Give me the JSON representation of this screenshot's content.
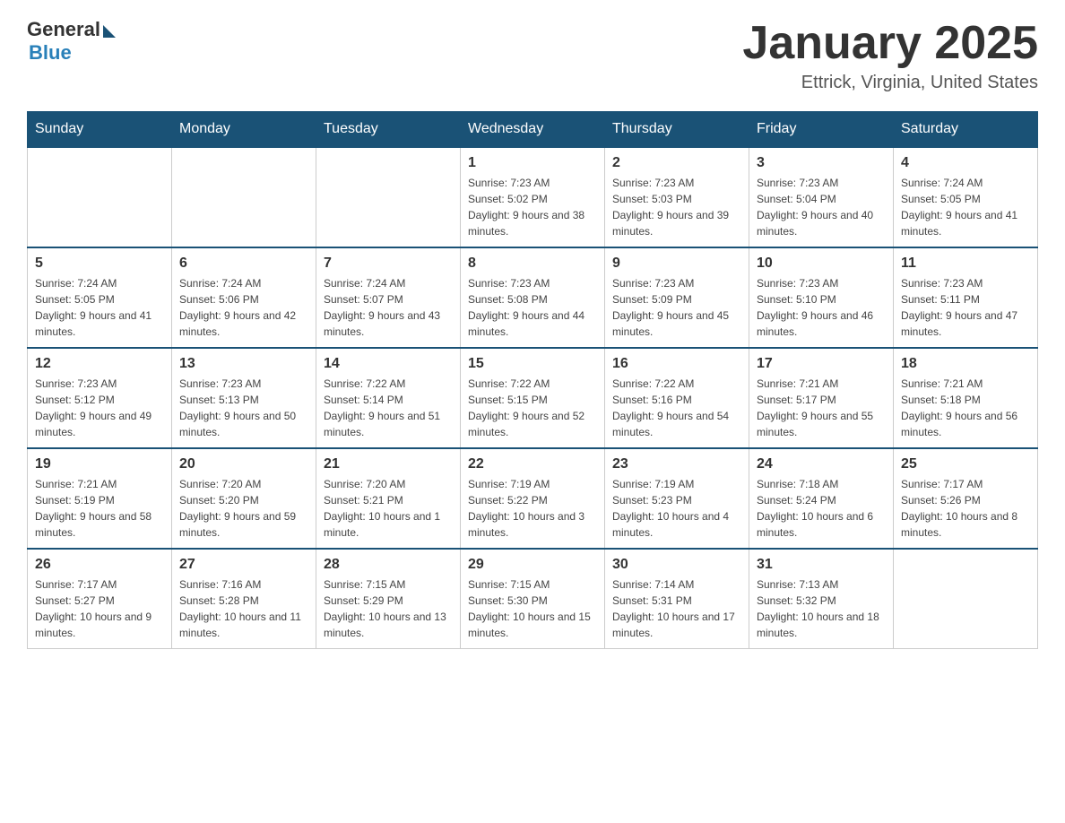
{
  "header": {
    "logo_general": "General",
    "logo_blue": "Blue",
    "month_title": "January 2025",
    "location": "Ettrick, Virginia, United States"
  },
  "days_of_week": [
    "Sunday",
    "Monday",
    "Tuesday",
    "Wednesday",
    "Thursday",
    "Friday",
    "Saturday"
  ],
  "weeks": [
    [
      null,
      null,
      null,
      {
        "num": "1",
        "sunrise": "7:23 AM",
        "sunset": "5:02 PM",
        "daylight": "9 hours and 38 minutes."
      },
      {
        "num": "2",
        "sunrise": "7:23 AM",
        "sunset": "5:03 PM",
        "daylight": "9 hours and 39 minutes."
      },
      {
        "num": "3",
        "sunrise": "7:23 AM",
        "sunset": "5:04 PM",
        "daylight": "9 hours and 40 minutes."
      },
      {
        "num": "4",
        "sunrise": "7:24 AM",
        "sunset": "5:05 PM",
        "daylight": "9 hours and 41 minutes."
      }
    ],
    [
      {
        "num": "5",
        "sunrise": "7:24 AM",
        "sunset": "5:05 PM",
        "daylight": "9 hours and 41 minutes."
      },
      {
        "num": "6",
        "sunrise": "7:24 AM",
        "sunset": "5:06 PM",
        "daylight": "9 hours and 42 minutes."
      },
      {
        "num": "7",
        "sunrise": "7:24 AM",
        "sunset": "5:07 PM",
        "daylight": "9 hours and 43 minutes."
      },
      {
        "num": "8",
        "sunrise": "7:23 AM",
        "sunset": "5:08 PM",
        "daylight": "9 hours and 44 minutes."
      },
      {
        "num": "9",
        "sunrise": "7:23 AM",
        "sunset": "5:09 PM",
        "daylight": "9 hours and 45 minutes."
      },
      {
        "num": "10",
        "sunrise": "7:23 AM",
        "sunset": "5:10 PM",
        "daylight": "9 hours and 46 minutes."
      },
      {
        "num": "11",
        "sunrise": "7:23 AM",
        "sunset": "5:11 PM",
        "daylight": "9 hours and 47 minutes."
      }
    ],
    [
      {
        "num": "12",
        "sunrise": "7:23 AM",
        "sunset": "5:12 PM",
        "daylight": "9 hours and 49 minutes."
      },
      {
        "num": "13",
        "sunrise": "7:23 AM",
        "sunset": "5:13 PM",
        "daylight": "9 hours and 50 minutes."
      },
      {
        "num": "14",
        "sunrise": "7:22 AM",
        "sunset": "5:14 PM",
        "daylight": "9 hours and 51 minutes."
      },
      {
        "num": "15",
        "sunrise": "7:22 AM",
        "sunset": "5:15 PM",
        "daylight": "9 hours and 52 minutes."
      },
      {
        "num": "16",
        "sunrise": "7:22 AM",
        "sunset": "5:16 PM",
        "daylight": "9 hours and 54 minutes."
      },
      {
        "num": "17",
        "sunrise": "7:21 AM",
        "sunset": "5:17 PM",
        "daylight": "9 hours and 55 minutes."
      },
      {
        "num": "18",
        "sunrise": "7:21 AM",
        "sunset": "5:18 PM",
        "daylight": "9 hours and 56 minutes."
      }
    ],
    [
      {
        "num": "19",
        "sunrise": "7:21 AM",
        "sunset": "5:19 PM",
        "daylight": "9 hours and 58 minutes."
      },
      {
        "num": "20",
        "sunrise": "7:20 AM",
        "sunset": "5:20 PM",
        "daylight": "9 hours and 59 minutes."
      },
      {
        "num": "21",
        "sunrise": "7:20 AM",
        "sunset": "5:21 PM",
        "daylight": "10 hours and 1 minute."
      },
      {
        "num": "22",
        "sunrise": "7:19 AM",
        "sunset": "5:22 PM",
        "daylight": "10 hours and 3 minutes."
      },
      {
        "num": "23",
        "sunrise": "7:19 AM",
        "sunset": "5:23 PM",
        "daylight": "10 hours and 4 minutes."
      },
      {
        "num": "24",
        "sunrise": "7:18 AM",
        "sunset": "5:24 PM",
        "daylight": "10 hours and 6 minutes."
      },
      {
        "num": "25",
        "sunrise": "7:17 AM",
        "sunset": "5:26 PM",
        "daylight": "10 hours and 8 minutes."
      }
    ],
    [
      {
        "num": "26",
        "sunrise": "7:17 AM",
        "sunset": "5:27 PM",
        "daylight": "10 hours and 9 minutes."
      },
      {
        "num": "27",
        "sunrise": "7:16 AM",
        "sunset": "5:28 PM",
        "daylight": "10 hours and 11 minutes."
      },
      {
        "num": "28",
        "sunrise": "7:15 AM",
        "sunset": "5:29 PM",
        "daylight": "10 hours and 13 minutes."
      },
      {
        "num": "29",
        "sunrise": "7:15 AM",
        "sunset": "5:30 PM",
        "daylight": "10 hours and 15 minutes."
      },
      {
        "num": "30",
        "sunrise": "7:14 AM",
        "sunset": "5:31 PM",
        "daylight": "10 hours and 17 minutes."
      },
      {
        "num": "31",
        "sunrise": "7:13 AM",
        "sunset": "5:32 PM",
        "daylight": "10 hours and 18 minutes."
      },
      null
    ]
  ]
}
